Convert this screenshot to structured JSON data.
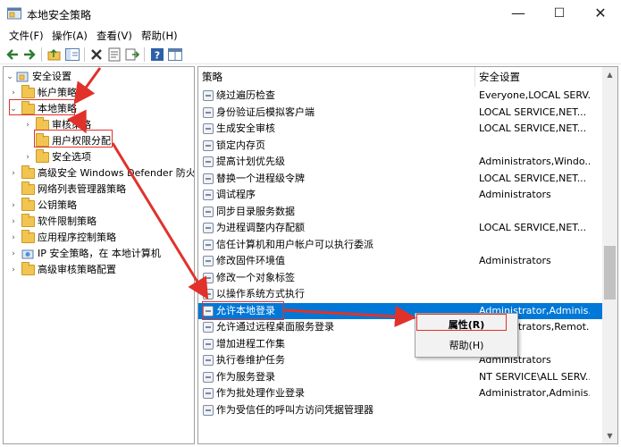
{
  "window": {
    "title": "本地安全策略",
    "minimize": "—",
    "maximize": "☐",
    "close": "✕"
  },
  "menu": [
    "文件(F)",
    "操作(A)",
    "查看(V)",
    "帮助(H)"
  ],
  "tree": [
    {
      "label": "安全设置",
      "arrow": "⌄",
      "icon": "security-settings-icon"
    },
    {
      "label": "帐户策略",
      "arrow": "›",
      "icon": "folder-icon"
    },
    {
      "label": "本地策略",
      "arrow": "⌄",
      "icon": "folder-open-icon"
    },
    {
      "label": "审核策略",
      "arrow": "›",
      "icon": "folder-icon"
    },
    {
      "label": "用户权限分配",
      "arrow": "",
      "icon": "folder-icon"
    },
    {
      "label": "安全选项",
      "arrow": "›",
      "icon": "folder-icon"
    },
    {
      "label": "高级安全 Windows Defender 防火墙",
      "arrow": "›",
      "icon": "folder-icon"
    },
    {
      "label": "网络列表管理器策略",
      "arrow": "",
      "icon": "folder-icon"
    },
    {
      "label": "公钥策略",
      "arrow": "›",
      "icon": "folder-icon"
    },
    {
      "label": "软件限制策略",
      "arrow": "›",
      "icon": "folder-icon"
    },
    {
      "label": "应用程序控制策略",
      "arrow": "›",
      "icon": "folder-icon"
    },
    {
      "label": "IP 安全策略，在 本地计算机",
      "arrow": "›",
      "icon": "ip-security-icon"
    },
    {
      "label": "高级审核策略配置",
      "arrow": "›",
      "icon": "folder-icon"
    }
  ],
  "columns": {
    "policy": "策略",
    "setting": "安全设置"
  },
  "policies": [
    {
      "name": "绕过遍历检查",
      "value": "Everyone,LOCAL SERV..."
    },
    {
      "name": "身份验证后模拟客户端",
      "value": "LOCAL SERVICE,NET..."
    },
    {
      "name": "生成安全审核",
      "value": "LOCAL SERVICE,NET..."
    },
    {
      "name": "锁定内存页",
      "value": ""
    },
    {
      "name": "提高计划优先级",
      "value": "Administrators,Windo..."
    },
    {
      "name": "替换一个进程级令牌",
      "value": "LOCAL SERVICE,NET..."
    },
    {
      "name": "调试程序",
      "value": "Administrators"
    },
    {
      "name": "同步目录服务数据",
      "value": ""
    },
    {
      "name": "为进程调整内存配额",
      "value": "LOCAL SERVICE,NET..."
    },
    {
      "name": "信任计算机和用户帐户可以执行委派",
      "value": ""
    },
    {
      "name": "修改固件环境值",
      "value": "Administrators"
    },
    {
      "name": "修改一个对象标签",
      "value": ""
    },
    {
      "name": "以操作系统方式执行",
      "value": ""
    },
    {
      "name": "允许本地登录",
      "value": "Administrator,Adminis..."
    },
    {
      "name": "允许通过远程桌面服务登录",
      "value": "Administrators,Remot..."
    },
    {
      "name": "增加进程工作集",
      "value": ""
    },
    {
      "name": "执行卷维护任务",
      "value": "Administrators"
    },
    {
      "name": "作为服务登录",
      "value": "NT SERVICE\\ALL SERV..."
    },
    {
      "name": "作为批处理作业登录",
      "value": "Administrator,Adminis..."
    },
    {
      "name": "作为受信任的呼叫方访问凭据管理器",
      "value": ""
    }
  ],
  "context_menu": {
    "properties": "属性(R)",
    "help": "帮助(H)"
  },
  "colors": {
    "selection": "#0078d7",
    "annotation": "#e0322b",
    "folder": "#f2c553"
  }
}
